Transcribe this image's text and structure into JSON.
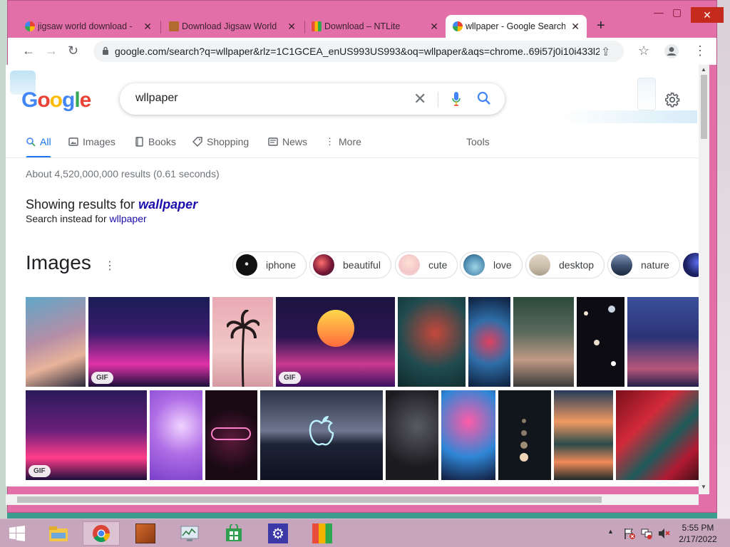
{
  "window": {
    "tabs": [
      {
        "title": "jigsaw world download - ",
        "close": "✕",
        "favicon": "google-icon"
      },
      {
        "title": "Download Jigsaw World",
        "close": "✕",
        "favicon": "jigsaw-icon"
      },
      {
        "title": "Download – NTLite",
        "close": "✕",
        "favicon": "ntlite-icon"
      },
      {
        "title": "wllpaper - Google Search",
        "close": "✕",
        "favicon": "google-icon"
      }
    ],
    "new_tab": "+",
    "minimize": "—",
    "maximize": "▢",
    "close": "✕"
  },
  "toolbar": {
    "back": "←",
    "forward": "→",
    "reload": "↻",
    "url": "google.com/search?q=wllpaper&rlz=1C1GCEA_enUS993US993&oq=wllpaper&aqs=chrome..69i57j0i10i433l2j0i...",
    "share": "⇪",
    "bookmark": "☆",
    "menu": "⋮"
  },
  "search": {
    "query": "wllpaper",
    "clear": "✕"
  },
  "logo": {
    "g1": "G",
    "o1": "o",
    "o2": "o",
    "g2": "g",
    "l": "l",
    "e": "e"
  },
  "tabs": [
    {
      "label": "All",
      "icon": "search-icon"
    },
    {
      "label": "Images",
      "icon": "image-icon"
    },
    {
      "label": "Books",
      "icon": "book-icon"
    },
    {
      "label": "Shopping",
      "icon": "tag-icon"
    },
    {
      "label": "News",
      "icon": "news-icon"
    },
    {
      "label": "More",
      "icon": "more-vertical-icon"
    }
  ],
  "tools": "Tools",
  "results": {
    "stats": "About 4,520,000,000 results (0.61 seconds)",
    "showing_prefix": "Showing results for ",
    "corrected": "wallpaper",
    "instead_prefix": "Search instead for ",
    "original": "wllpaper"
  },
  "images": {
    "heading": "Images",
    "more": "⋮",
    "chips": [
      "iphone",
      "beautiful",
      "cute",
      "love",
      "desktop",
      "nature"
    ],
    "gif_label": "GIF"
  },
  "taskbar": {
    "time": "5:55 PM",
    "date": "2/17/2022",
    "tray_up": "▲"
  }
}
